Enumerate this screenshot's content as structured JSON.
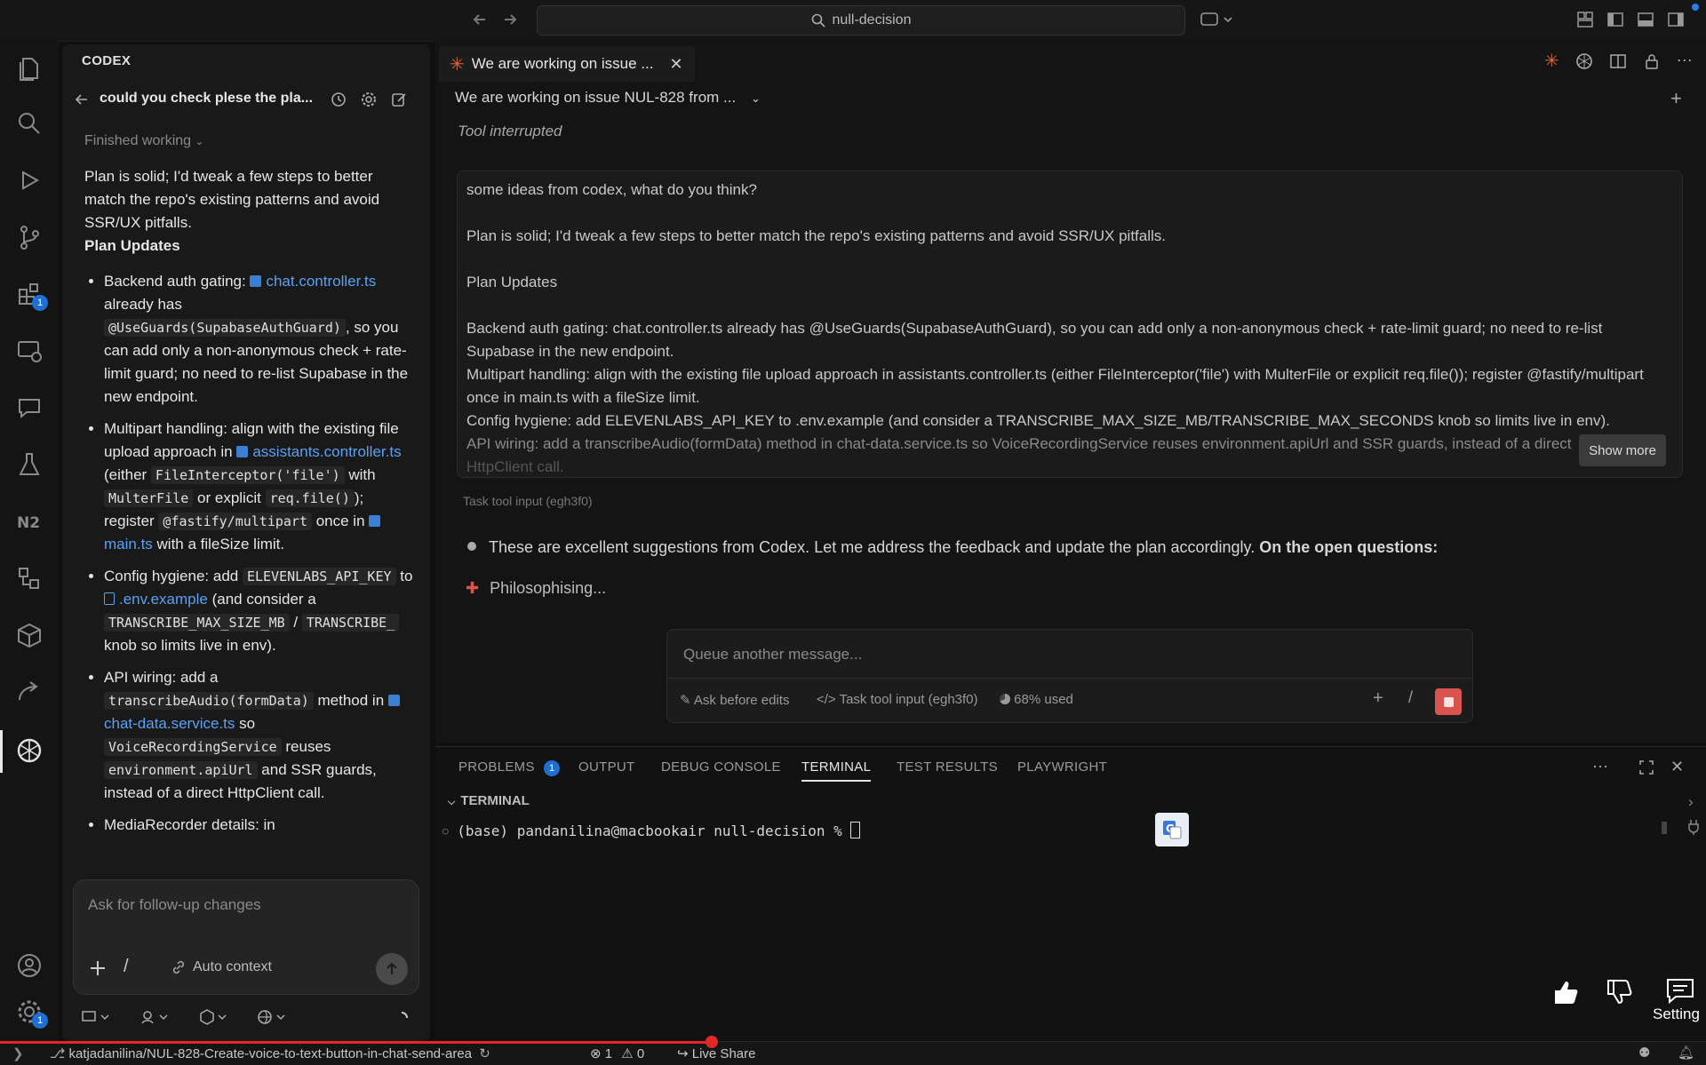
{
  "titlebar": {
    "search": "null-decision"
  },
  "activity_bar": {
    "extensions_badge": "1",
    "settings_badge": "1"
  },
  "codex": {
    "header": "CODEX",
    "thread_title": "could you check plese the pla...",
    "status": "Finished working",
    "intro": "Plan is solid; I'd tweak a few steps to better match the repo's existing patterns and avoid SSR/UX pitfalls.",
    "plan_heading": "Plan Updates",
    "items": {
      "auth_label": "Backend auth gating:",
      "auth_file": "chat.controller.ts",
      "auth_text1": " already has ",
      "auth_code": "@UseGuards(SupabaseAuthGuard)",
      "auth_text2": ", so you can add only a non-anonymous check + rate-limit guard; no need to re-list Supabase in the new endpoint.",
      "mp_text1": "Multipart handling: align with the existing file upload approach in ",
      "mp_file": "assistants.controller.ts",
      "mp_text2": " (either ",
      "mp_code1": "FileInterceptor('file')",
      "mp_text3": " with ",
      "mp_code2": "MulterFile",
      "mp_text4": " or explicit ",
      "mp_code3": "req.file()",
      "mp_text5": "); register ",
      "mp_code4": "@fastify/multipart",
      "mp_text6": " once in ",
      "mp_file2": "main.ts",
      "mp_text7": " with a fileSize limit.",
      "cfg_text1": "Config hygiene: add ",
      "cfg_code1": "ELEVENLABS_API_KEY",
      "cfg_text2": " to ",
      "cfg_file": ".env.example",
      "cfg_text3": " (and consider a ",
      "cfg_code2": "TRANSCRIBE_MAX_SIZE_MB",
      "cfg_text4": " / ",
      "cfg_code3": "TRANSCRIBE_",
      "cfg_text5": "knob so limits live in env).",
      "api_text1": "API wiring: add a ",
      "api_code1": "transcribeAudio(formData)",
      "api_text2": " method in ",
      "api_file": "chat-data.service.ts",
      "api_text3": " so ",
      "api_code2": "VoiceRecordingService",
      "api_text4": " reuses ",
      "api_code3": "environment.apiUrl",
      "api_text5": " and SSR guards, instead of a direct HttpClient call.",
      "media_text": "MediaRecorder details: in"
    },
    "followup_placeholder": "Ask for follow-up changes",
    "auto_context": "Auto context"
  },
  "editor": {
    "tab_label": "We are working on issue ...",
    "session_title": "We are working on issue NUL-828 from ...",
    "tool_interrupted": "Tool interrupted",
    "message": {
      "line1": "some ideas from codex, what do you think?",
      "line2": "Plan is solid; I'd tweak a few steps to better match the repo's existing patterns and avoid SSR/UX pitfalls.",
      "line3": "Plan Updates",
      "line4": "Backend auth gating: chat.controller.ts already has @UseGuards(SupabaseAuthGuard), so you can add only a non-anonymous check + rate-limit guard; no need to re-list Supabase in the new endpoint.",
      "line5": "Multipart handling: align with the existing file upload approach in assistants.controller.ts (either FileInterceptor('file') with MulterFile or explicit req.file()); register @fastify/multipart once in main.ts with a fileSize limit.",
      "line6": "Config hygiene: add ELEVENLABS_API_KEY to .env.example (and consider a TRANSCRIBE_MAX_SIZE_MB/TRANSCRIBE_MAX_SECONDS knob so limits live in env).",
      "line7": "API wiring: add a transcribeAudio(formData) method in chat-data.service.ts so VoiceRecordingService reuses environment.apiUrl and SSR guards, instead of a direct",
      "line8": "HttpClient call."
    },
    "show_more": "Show more",
    "task_tool_input": "Task tool input (egh3f0)",
    "assistant_reply": "These are excellent suggestions from Codex. Let me address the feedback and update the plan accordingly. ",
    "assistant_reply_bold": "On the open questions:",
    "thinking": "Philosophising...",
    "queue_placeholder": "Queue another message...",
    "ask_before_edits": "Ask before edits",
    "task_chip": "Task tool input (egh3f0)",
    "context_used": "68% used",
    "slash": "/"
  },
  "panel": {
    "tabs": [
      "PROBLEMS",
      "OUTPUT",
      "DEBUG CONSOLE",
      "TERMINAL",
      "TEST RESULTS",
      "PLAYWRIGHT"
    ],
    "problems_count": "1",
    "active_tab": "TERMINAL",
    "section": "TERMINAL",
    "prompt": "(base) pandanilina@macbookair null-decision % "
  },
  "overlay": {
    "setting_label": "Setting"
  },
  "statusbar": {
    "branch": "katjadanilina/NUL-828-Create-voice-to-text-button-in-chat-send-area",
    "errors": "1",
    "warnings": "0",
    "live_share": "Live Share"
  },
  "colors": {
    "accent": "#5ca0f2",
    "stop": "#d9534f",
    "claude": "#d9663a",
    "badge": "#1f6fd1"
  }
}
